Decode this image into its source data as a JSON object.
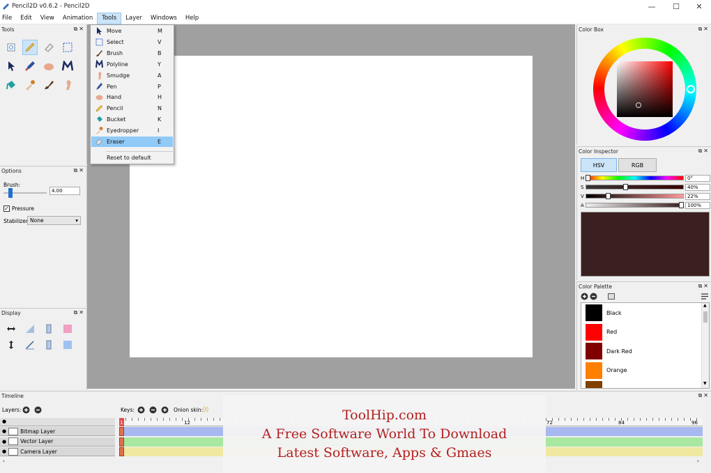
{
  "window": {
    "title": "Pencil2D v0.6.2 - Pencil2D",
    "minimize": "—",
    "maximize": "☐",
    "close": "✕"
  },
  "menubar": [
    "File",
    "Edit",
    "View",
    "Animation",
    "Tools",
    "Layer",
    "Windows",
    "Help"
  ],
  "tools_panel": {
    "title": "Tools",
    "controls": "⧉✕"
  },
  "tools_menu": {
    "items": [
      {
        "label": "Move",
        "shortcut": "M",
        "icon": "move-icon"
      },
      {
        "label": "Select",
        "shortcut": "V",
        "icon": "select-icon"
      },
      {
        "label": "Brush",
        "shortcut": "B",
        "icon": "brush-icon"
      },
      {
        "label": "Polyline",
        "shortcut": "Y",
        "icon": "polyline-icon"
      },
      {
        "label": "Smudge",
        "shortcut": "A",
        "icon": "smudge-icon"
      },
      {
        "label": "Pen",
        "shortcut": "P",
        "icon": "pen-icon"
      },
      {
        "label": "Hand",
        "shortcut": "H",
        "icon": "hand-icon"
      },
      {
        "label": "Pencil",
        "shortcut": "N",
        "icon": "pencil-icon"
      },
      {
        "label": "Bucket",
        "shortcut": "K",
        "icon": "bucket-icon"
      },
      {
        "label": "Eyedropper",
        "shortcut": "I",
        "icon": "eyedropper-icon"
      },
      {
        "label": "Eraser",
        "shortcut": "E",
        "icon": "eraser-icon"
      }
    ],
    "highlighted": "Eraser",
    "reset": "Reset to default"
  },
  "options_panel": {
    "title": "Options",
    "brush_label": "Brush:",
    "brush_value": "4.00",
    "pressure_label": "Pressure",
    "pressure_checked": true,
    "stabilizer_label": "Stabilizer",
    "stabilizer_value": "None"
  },
  "display_panel": {
    "title": "Display"
  },
  "color_box": {
    "title": "Color Box"
  },
  "color_inspector": {
    "title": "Color Inspector",
    "tab_hsv": "HSV",
    "tab_rgb": "RGB",
    "h_label": "H",
    "h_value": "0°",
    "h_fraction": 0,
    "s_label": "S",
    "s_value": "40%",
    "s_fraction": 0.4,
    "v_label": "V",
    "v_value": "22%",
    "v_fraction": 0.22,
    "a_label": "A",
    "a_value": "100%",
    "a_fraction": 1.0,
    "preview_color": "#3a2020"
  },
  "color_palette": {
    "title": "Color Palette",
    "colors": [
      {
        "name": "Black",
        "hex": "#000000"
      },
      {
        "name": "Red",
        "hex": "#ff0000"
      },
      {
        "name": "Dark Red",
        "hex": "#800000"
      },
      {
        "name": "Orange",
        "hex": "#ff8000"
      }
    ]
  },
  "timeline": {
    "title": "Timeline",
    "layers_label": "Layers:",
    "keys_label": "Keys:",
    "onion_label": "Onion skin:",
    "ruler": [
      "1",
      "12",
      "72",
      "84",
      "96"
    ],
    "layers": [
      {
        "name": "Bitmap Layer",
        "color": "#a8b8f0"
      },
      {
        "name": "Vector Layer",
        "color": "#a8e8a0"
      },
      {
        "name": "Camera Layer",
        "color": "#f0e8a0"
      }
    ]
  },
  "watermark": {
    "line1": "ToolHip.com",
    "line2": "A Free Software World To Download",
    "line3": "Latest Software, Apps & Gmaes"
  },
  "colors": {
    "canvas_bg": "#a0a0a0",
    "highlight": "#91c9f7",
    "accent_red": "#b22020"
  }
}
